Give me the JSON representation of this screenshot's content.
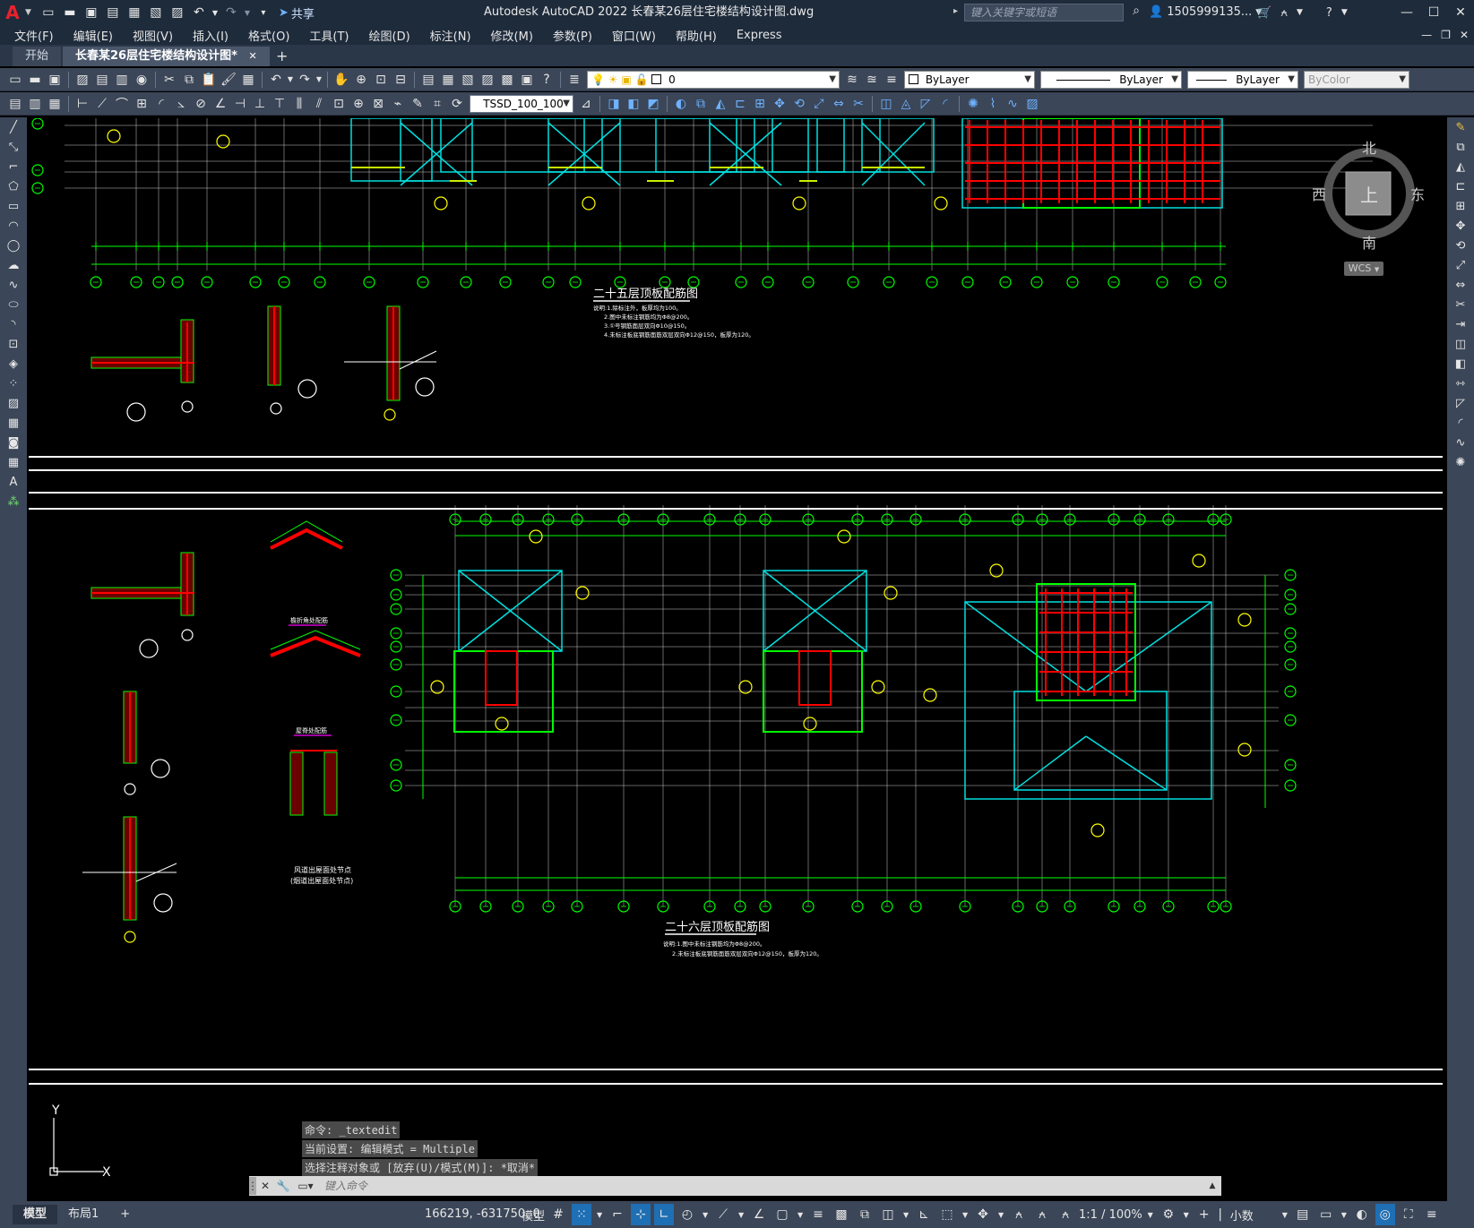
{
  "titlebar": {
    "app_logo": "A",
    "share_label": "共享",
    "title": "Autodesk AutoCAD 2022    长春某26层住宅楼结构设计图.dwg",
    "search_placeholder": "键入关键字或短语",
    "user_name": "1505999135..."
  },
  "menu": [
    "文件(F)",
    "编辑(E)",
    "视图(V)",
    "插入(I)",
    "格式(O)",
    "工具(T)",
    "绘图(D)",
    "标注(N)",
    "修改(M)",
    "参数(P)",
    "窗口(W)",
    "帮助(H)",
    "Express"
  ],
  "tabs": [
    {
      "label": "开始",
      "active": false
    },
    {
      "label": "长春某26层住宅楼结构设计图*",
      "active": true
    }
  ],
  "toolbar": {
    "layer_value": "0",
    "color_value": "ByLayer",
    "linetype_value": "ByLayer",
    "lineweight_value": "ByLayer",
    "plotstyle_value": "ByColor",
    "textstyle_value": "TSSD_100_100"
  },
  "viewcube": {
    "north": "北",
    "south": "南",
    "east": "东",
    "west": "西",
    "top": "上",
    "wcs": "WCS"
  },
  "drawing": {
    "plan1_title": "二十五层顶板配筋图",
    "plan1_notes": [
      "说明:1.除标注外，板厚均为100。",
      "2.图中未标注钢筋均为Φ8@200。",
      "3.①号钢筋面层双向Φ10@150。",
      "4.未标注板底钢筋面筋双层双向Φ12@150，板厚为120。"
    ],
    "plan2_title": "二十六层顶板配筋图",
    "plan2_notes": [
      "说明:1.图中未标注钢筋均为Φ8@200。",
      "2.未标注板底钢筋面筋双层双向Φ12@150，板厚为120。"
    ],
    "detail_label_1": "檐折角处配筋",
    "detail_label_2": "屋脊处配筋",
    "detail_label_3": "风道出屋面处节点",
    "detail_label_4": "(烟道出屋面处节点)",
    "ucs_y": "Y",
    "ucs_x": "X"
  },
  "command": {
    "history": [
      "命令: _textedit",
      "当前设置: 编辑模式 = Multiple",
      "选择注释对象或 [放弃(U)/模式(M)]: *取消*"
    ],
    "placeholder": "键入命令"
  },
  "status": {
    "layouts": [
      {
        "label": "模型",
        "active": true
      },
      {
        "label": "布局1",
        "active": false
      }
    ],
    "coords": "166219, -631750, 0",
    "model_label": "模型",
    "scale": "1:1 / 100%",
    "units": "小数"
  },
  "colors": {
    "title_bg": "#1e2b3b",
    "toolbar_bg": "#3b4658",
    "canvas_bg": "#000000",
    "axis_green": "#00ff00",
    "cyan": "#00e0e0",
    "rebar_red": "#ff0000",
    "yellow": "#ffff00"
  }
}
